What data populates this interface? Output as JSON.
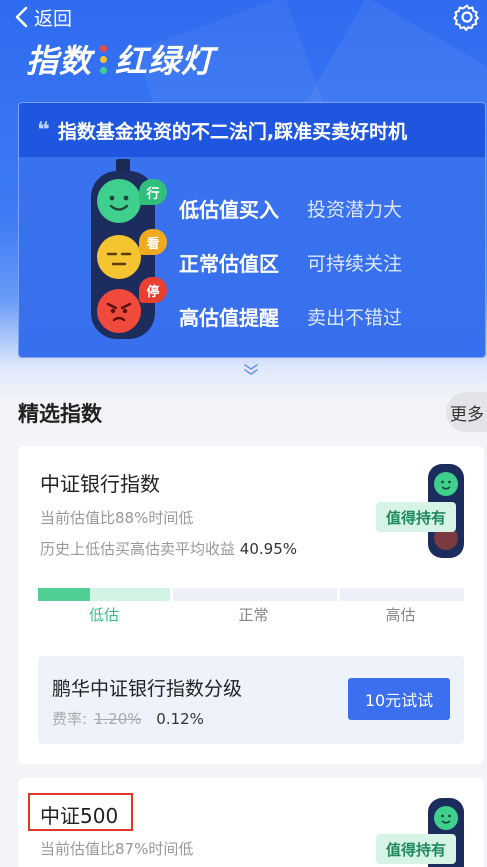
{
  "nav": {
    "back_label": "返回"
  },
  "hero": {
    "title_left": "指数",
    "title_right": "红绿灯"
  },
  "banner": {
    "headline": "指数基金投资的不二法门,踩准买卖好时机",
    "light_tags": [
      "行",
      "看",
      "停"
    ],
    "rows": [
      {
        "key": "低估值买入",
        "value": "投资潜力大"
      },
      {
        "key": "正常估值区",
        "value": "可持续关注"
      },
      {
        "key": "高估值提醒",
        "value": "卖出不错过"
      }
    ]
  },
  "section": {
    "title": "精选指数",
    "more_label": "更多"
  },
  "cards": [
    {
      "title": "中证银行指数",
      "valuation_text": "当前估值比88%时间低",
      "return_text": "历史上低估买高估卖平均收益",
      "return_value": "40.95%",
      "badge": "值得持有",
      "scale_labels": [
        "低估",
        "正常",
        "高估"
      ],
      "fund": {
        "name": "鹏华中证银行指数分级",
        "rate_label": "费率:",
        "rate_original": "1.20%",
        "rate_current": "0.12%",
        "button_label": "10元试试"
      }
    },
    {
      "title": "中证500",
      "valuation_text": "当前估值比87%时间低",
      "badge": "值得持有"
    }
  ],
  "colors": {
    "brand_blue": "#2f6bf0",
    "green": "#3fd08e",
    "yellow": "#f5c431",
    "red": "#f04a3c",
    "highlight_box": "#e5352a"
  }
}
